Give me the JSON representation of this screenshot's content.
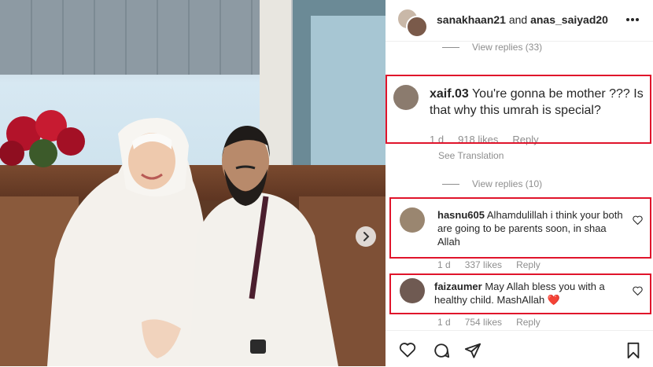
{
  "header": {
    "user1": "sanakhaan21",
    "connector": " and ",
    "user2": "anas_saiyad20"
  },
  "replies_top": {
    "label": "View replies (33)"
  },
  "comments": [
    {
      "username": "xaif.03",
      "text": " You're gonna be mother ??? Is that why this umrah is special?",
      "time": "1 d",
      "likes": "918 likes",
      "reply": "Reply",
      "translation": "See Translation"
    },
    {
      "username": "hasnu605",
      "text": " Alhamdulillah i think your both are going to be parents soon, in shaa Allah",
      "time": "1 d",
      "likes": "337 likes",
      "reply": "Reply"
    },
    {
      "username": "faizaumer",
      "text": " May Allah bless you with a healthy child. MashAllah",
      "emoji": "❤️",
      "time": "1 d",
      "likes": "754 likes",
      "reply": "Reply"
    }
  ],
  "replies_mid": {
    "label": "View replies (10)"
  },
  "colors": {
    "highlight": "#e0142b",
    "heart": "#ed4956",
    "meta": "#8e8e8e"
  },
  "icons": [
    "more-icon",
    "heart-icon",
    "comment-icon",
    "share-icon",
    "bookmark-icon",
    "chevron-right-icon"
  ]
}
